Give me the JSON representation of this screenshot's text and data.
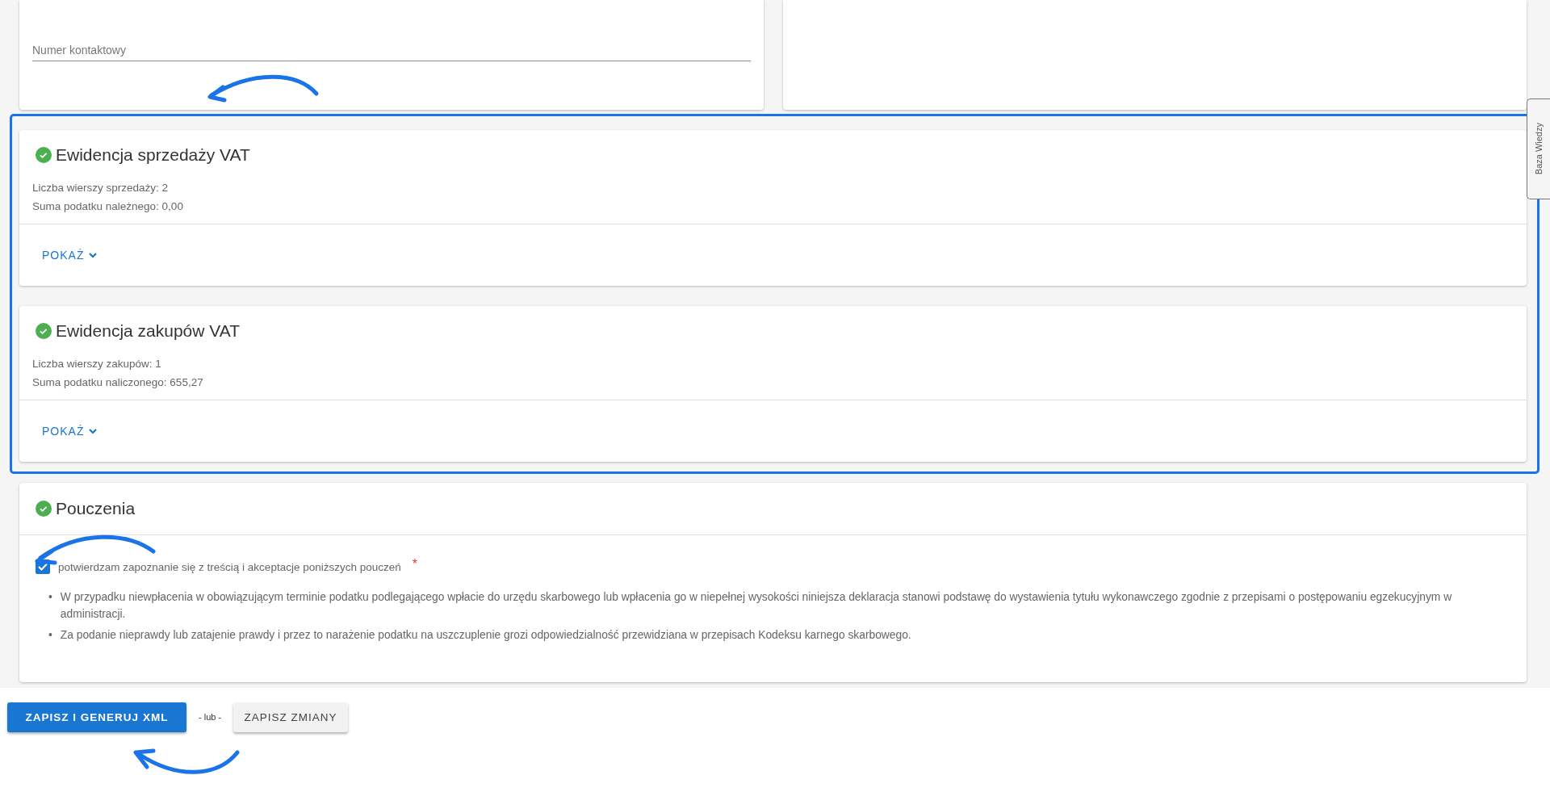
{
  "contact_card": {
    "field": {
      "placeholder": "Numer kontaktowy"
    }
  },
  "side_tab": {
    "label": "Baza Wiedzy"
  },
  "sections": {
    "highlighted": true,
    "items": [
      {
        "title": "Ewidencja sprzedaży VAT",
        "complete": true,
        "stats": [
          "Liczba wierszy sprzedaży: 2",
          "Suma podatku należnego: 0,00"
        ],
        "toggle": "POKAŻ",
        "expanded": false
      },
      {
        "title": "Ewidencja zakupów VAT",
        "complete": true,
        "stats": [
          "Liczba wierszy zakupów: 1",
          "Suma podatku naliczonego: 655,27"
        ],
        "toggle": "POKAŻ",
        "expanded": false
      }
    ]
  },
  "instructions": {
    "title": "Pouczenia",
    "complete": true,
    "consent": {
      "label": "potwierdzam zapoznanie się z treścią i akceptacje poniższych pouczeń",
      "required_mark": "*",
      "checked": true
    },
    "items": [
      {
        "marker": "•",
        "text": "W przypadku niewpłacenia w obowiązującym terminie podatku podlegającego wpłacie do urzędu skarbowego lub wpłacenia go w niepełnej wysokości niniejsza deklaracja stanowi podstawę do wystawienia tytułu wykonawczego zgodnie z przepisami o postępowaniu egzekucyjnym w administracji."
      },
      {
        "marker": "•",
        "text": "Za podanie nieprawdy lub zatajenie prawdy i przez to narażenie podatku na uszczuplenie grozi odpowiedzialność przewidziana w przepisach Kodeksu karnego skarbowego."
      }
    ]
  },
  "actions": [
    {
      "kind": "primary",
      "label": "ZAPISZ I GENERUJ XML"
    },
    {
      "kind": "separator",
      "label": "- lub -"
    },
    {
      "kind": "secondary",
      "label": "ZAPISZ ZMIANY"
    }
  ]
}
